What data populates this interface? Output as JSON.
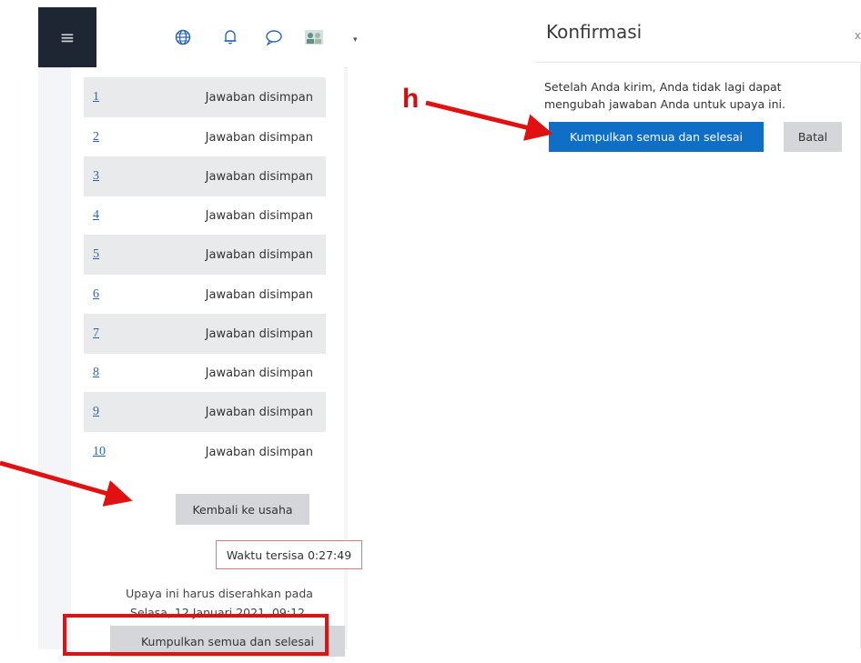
{
  "left_panel": {
    "nav": {
      "hamburger_glyph": "≡",
      "icons": [
        "globe-icon",
        "bell-icon",
        "chat-icon",
        "user-avatar-icon"
      ],
      "caret": "▾"
    },
    "questions": [
      {
        "num": "1",
        "status": "Jawaban disimpan"
      },
      {
        "num": "2",
        "status": "Jawaban disimpan"
      },
      {
        "num": "3",
        "status": "Jawaban disimpan"
      },
      {
        "num": "4",
        "status": "Jawaban disimpan"
      },
      {
        "num": "5",
        "status": "Jawaban disimpan"
      },
      {
        "num": "6",
        "status": "Jawaban disimpan"
      },
      {
        "num": "7",
        "status": "Jawaban disimpan"
      },
      {
        "num": "8",
        "status": "Jawaban disimpan"
      },
      {
        "num": "9",
        "status": "Jawaban disimpan"
      },
      {
        "num": "10",
        "status": "Jawaban disimpan"
      }
    ],
    "back_button": "Kembali ke usaha",
    "timer": "Waktu tersisa 0:27:49",
    "due_line1": "Upaya ini harus diserahkan pada",
    "due_line2": "Selasa, 12 Januari 2021, 09:12.",
    "submit_button": "Kumpulkan semua dan selesai"
  },
  "dialog": {
    "title": "Konfirmasi",
    "close_glyph": "x",
    "message_line1": "Setelah Anda kirim, Anda tidak lagi dapat",
    "message_line2": "mengubah jawaban Anda untuk upaya ini.",
    "confirm_button": "Kumpulkan semua dan selesai",
    "cancel_button": "Batal"
  },
  "annotation": {
    "step_label": "h",
    "color": "#e11111"
  }
}
